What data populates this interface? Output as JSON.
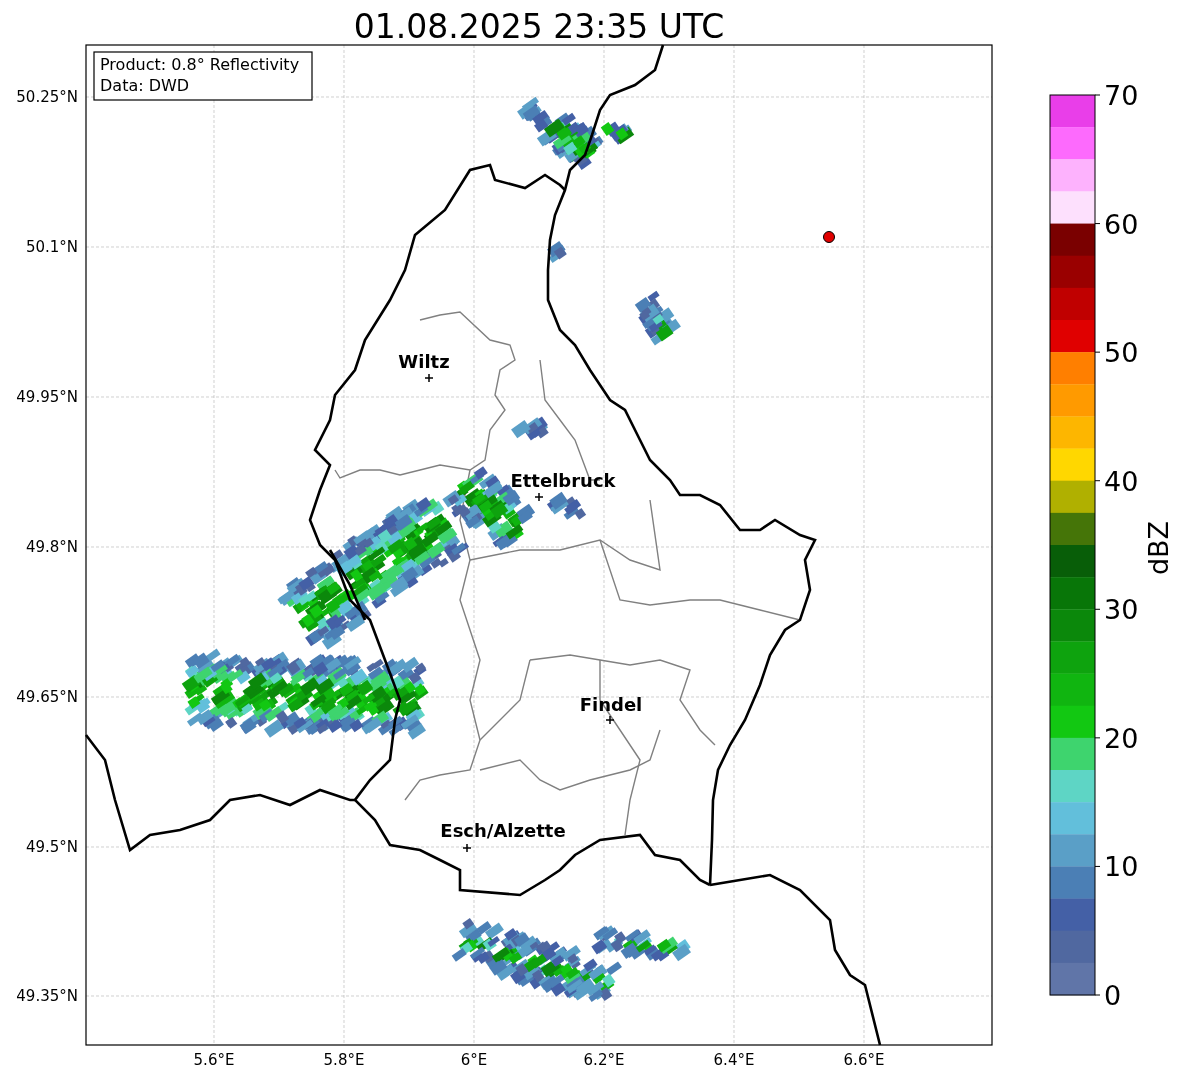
{
  "title": "01.08.2025 23:35 UTC",
  "info_box": {
    "lines": [
      "Product: 0.8° Reflectivity",
      "Data: DWD"
    ]
  },
  "map": {
    "lat_labels": [
      "50.25°N",
      "50.1°N",
      "49.95°N",
      "49.8°N",
      "49.65°N",
      "49.5°N",
      "49.35°N"
    ],
    "lon_labels": [
      "5.6°E",
      "5.8°E",
      "6°E",
      "6.2°E",
      "6.4°E",
      "6.6°E"
    ],
    "cities": [
      {
        "name": "Wiltz"
      },
      {
        "name": "Ettelbruck"
      },
      {
        "name": "Findel"
      },
      {
        "name": "Esch/Alzette"
      }
    ]
  },
  "colorbar": {
    "label": "dBZ",
    "ticks": [
      "70",
      "60",
      "50",
      "40",
      "30",
      "20",
      "10",
      "0"
    ],
    "bins": [
      {
        "color": "#e93ee9"
      },
      {
        "color": "#fd6afd"
      },
      {
        "color": "#fdb2fd"
      },
      {
        "color": "#fde0fd"
      },
      {
        "color": "#7a0000"
      },
      {
        "color": "#9a0000"
      },
      {
        "color": "#c00000"
      },
      {
        "color": "#e00000"
      },
      {
        "color": "#ff7f00"
      },
      {
        "color": "#ff9a00"
      },
      {
        "color": "#fdb600"
      },
      {
        "color": "#ffd700"
      },
      {
        "color": "#b0b000"
      },
      {
        "color": "#457508"
      },
      {
        "color": "#085e08"
      },
      {
        "color": "#087608"
      },
      {
        "color": "#0b880b"
      },
      {
        "color": "#0ea30e"
      },
      {
        "color": "#10b510"
      },
      {
        "color": "#12c812"
      },
      {
        "color": "#3ed46e"
      },
      {
        "color": "#5ed5c5"
      },
      {
        "color": "#62bfdb"
      },
      {
        "color": "#5a9fc7"
      },
      {
        "color": "#4b7fb5"
      },
      {
        "color": "#4460a6"
      },
      {
        "color": "#5068a0"
      },
      {
        "color": "#6075a8"
      }
    ]
  }
}
